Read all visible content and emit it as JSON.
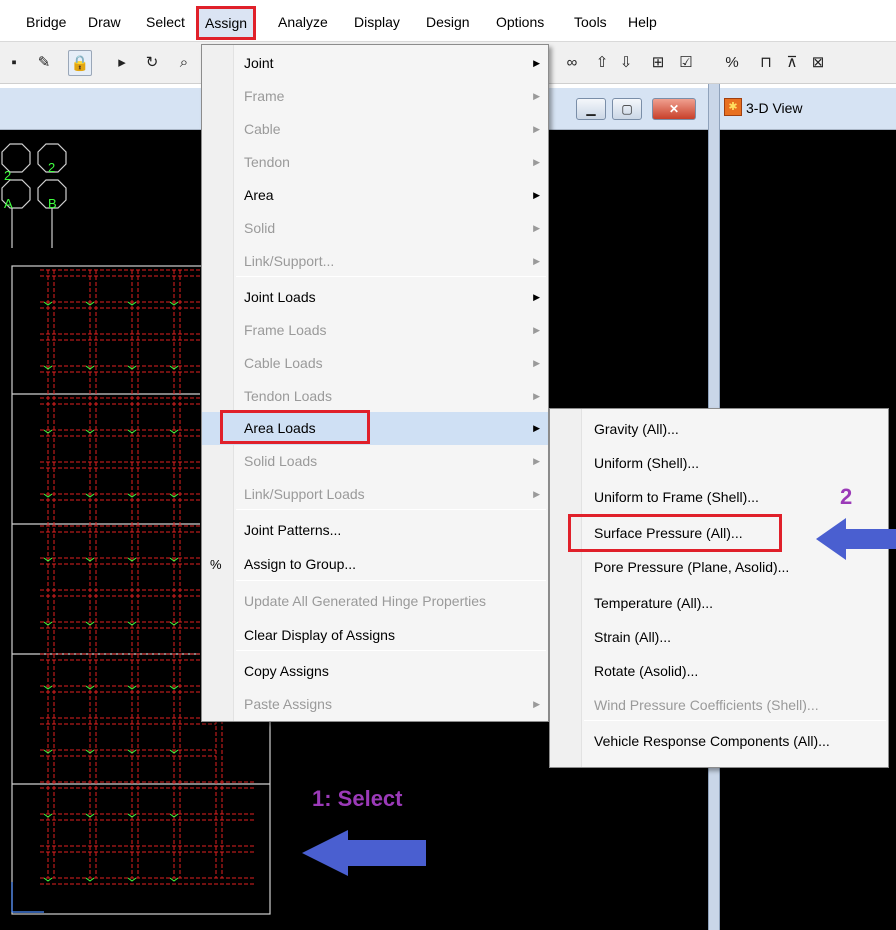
{
  "menubar": {
    "items": [
      "Bridge",
      "Draw",
      "Select",
      "Assign",
      "Analyze",
      "Display",
      "Design",
      "Options",
      "Tools",
      "Help"
    ]
  },
  "view": {
    "title": "3-D View"
  },
  "grid_labels": [
    "2",
    "2",
    "A",
    "B"
  ],
  "assign_menu": {
    "items": [
      {
        "label": "Joint",
        "enabled": true,
        "submenu": true
      },
      {
        "label": "Frame",
        "enabled": false,
        "submenu": true
      },
      {
        "label": "Cable",
        "enabled": false,
        "submenu": true
      },
      {
        "label": "Tendon",
        "enabled": false,
        "submenu": true
      },
      {
        "label": "Area",
        "enabled": true,
        "submenu": true
      },
      {
        "label": "Solid",
        "enabled": false,
        "submenu": true
      },
      {
        "label": "Link/Support...",
        "enabled": false,
        "submenu": true
      },
      {
        "label": "Joint Loads",
        "enabled": true,
        "submenu": true
      },
      {
        "label": "Frame Loads",
        "enabled": false,
        "submenu": true
      },
      {
        "label": "Cable Loads",
        "enabled": false,
        "submenu": true
      },
      {
        "label": "Tendon Loads",
        "enabled": false,
        "submenu": true
      },
      {
        "label": "Area Loads",
        "enabled": true,
        "submenu": true
      },
      {
        "label": "Solid Loads",
        "enabled": false,
        "submenu": true
      },
      {
        "label": "Link/Support Loads",
        "enabled": false,
        "submenu": true
      },
      {
        "label": "Joint Patterns...",
        "enabled": true,
        "submenu": false
      },
      {
        "label": "Assign to Group...",
        "enabled": true,
        "submenu": false
      },
      {
        "label": "Update All Generated Hinge Properties",
        "enabled": false,
        "submenu": false
      },
      {
        "label": "Clear Display of Assigns",
        "enabled": true,
        "submenu": false
      },
      {
        "label": "Copy Assigns",
        "enabled": true,
        "submenu": false
      },
      {
        "label": "Paste Assigns",
        "enabled": false,
        "submenu": true
      }
    ]
  },
  "area_loads_menu": {
    "items": [
      {
        "label": "Gravity (All)...",
        "enabled": true
      },
      {
        "label": "Uniform (Shell)...",
        "enabled": true
      },
      {
        "label": "Uniform to Frame (Shell)...",
        "enabled": true
      },
      {
        "label": "Surface Pressure (All)...",
        "enabled": true
      },
      {
        "label": "Pore Pressure (Plane, Asolid)...",
        "enabled": true
      },
      {
        "label": "Temperature (All)...",
        "enabled": true
      },
      {
        "label": "Strain (All)...",
        "enabled": true
      },
      {
        "label": "Rotate (Asolid)...",
        "enabled": true
      },
      {
        "label": "Wind Pressure Coefficients (Shell)...",
        "enabled": false
      },
      {
        "label": "Vehicle Response Components (All)...",
        "enabled": true
      }
    ]
  },
  "annotations": {
    "step1": "1: Select",
    "step2": "2"
  },
  "colors": {
    "highlight_box": "#e0202a",
    "arrow": "#4a5fd0",
    "annotation_text": "#9b3ab8"
  }
}
